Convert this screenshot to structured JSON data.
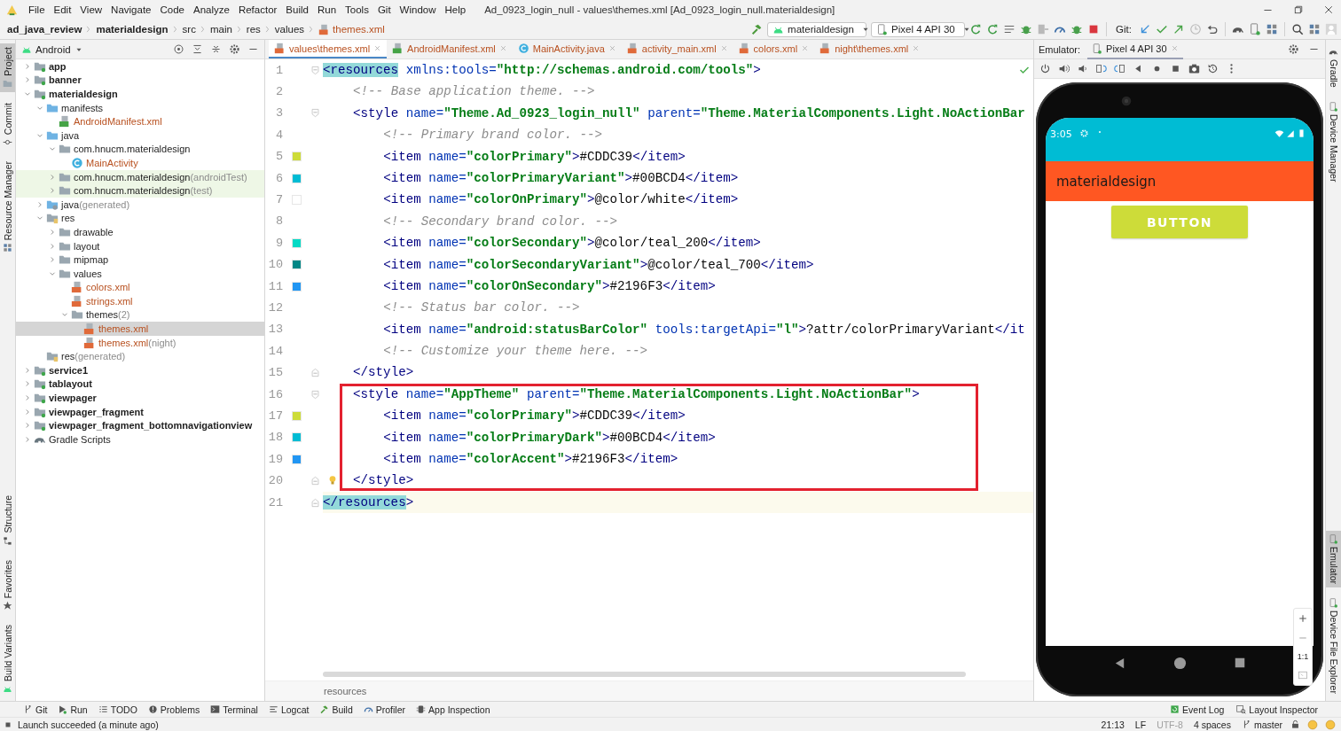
{
  "menu": [
    "File",
    "Edit",
    "View",
    "Navigate",
    "Code",
    "Analyze",
    "Refactor",
    "Build",
    "Run",
    "Tools",
    "Git",
    "Window",
    "Help"
  ],
  "window_title": "Ad_0923_login_null - values\\themes.xml [Ad_0923_login_null.materialdesign]",
  "breadcrumb": [
    {
      "label": "ad_java_review",
      "kind": "project"
    },
    {
      "label": "materialdesign",
      "kind": "module"
    },
    {
      "label": "src",
      "kind": "folder"
    },
    {
      "label": "main",
      "kind": "folder"
    },
    {
      "label": "res",
      "kind": "folder"
    },
    {
      "label": "values",
      "kind": "folder"
    },
    {
      "label": "themes.xml",
      "kind": "file"
    }
  ],
  "toolbar": {
    "run_config": "materialdesign",
    "device": "Pixel 4 API 30",
    "git_label": "Git:"
  },
  "left_tool_windows": {
    "top": [
      {
        "label": "Project",
        "selected": true
      },
      {
        "label": "Commit",
        "selected": false
      },
      {
        "label": "Resource Manager",
        "selected": false
      }
    ],
    "bottom": [
      {
        "label": "Structure",
        "selected": false
      },
      {
        "label": "Favorites",
        "selected": false
      },
      {
        "label": "Build Variants",
        "selected": false
      }
    ]
  },
  "project_panel": {
    "view": "Android",
    "tree": [
      {
        "label": "app",
        "kind": "module",
        "expanded": false,
        "selected": false,
        "highlighted": false
      },
      {
        "label": "banner",
        "kind": "module",
        "expanded": false,
        "selected": false,
        "highlighted": false
      },
      {
        "label": "materialdesign",
        "kind": "module",
        "expanded": true,
        "selected": false,
        "highlighted": false,
        "children": [
          {
            "label": "manifests",
            "kind": "source_folder",
            "expanded": true,
            "selected": false,
            "highlighted": false,
            "children": [
              {
                "label": "AndroidManifest.xml",
                "kind": "manifest",
                "selected": false,
                "highlighted": false
              }
            ]
          },
          {
            "label": "java",
            "kind": "source_folder",
            "expanded": true,
            "selected": false,
            "highlighted": false,
            "children": [
              {
                "label": "com.hnucm.materialdesign",
                "kind": "package",
                "expanded": true,
                "selected": false,
                "highlighted": false,
                "children": [
                  {
                    "label": "MainActivity",
                    "kind": "class",
                    "selected": false,
                    "highlighted": false
                  }
                ]
              },
              {
                "label": "com.hnucm.materialdesign",
                "suffix": "(androidTest)",
                "kind": "package",
                "expanded": false,
                "selected": false,
                "highlighted": true
              },
              {
                "label": "com.hnucm.materialdesign",
                "suffix": "(test)",
                "kind": "package",
                "expanded": false,
                "selected": false,
                "highlighted": true
              }
            ]
          },
          {
            "label": "java",
            "suffix": "(generated)",
            "kind": "generated_folder",
            "expanded": false,
            "selected": false,
            "highlighted": false
          },
          {
            "label": "res",
            "kind": "res_folder",
            "expanded": true,
            "selected": false,
            "highlighted": false,
            "children": [
              {
                "label": "drawable",
                "kind": "package",
                "expanded": false,
                "selected": false,
                "highlighted": false
              },
              {
                "label": "layout",
                "kind": "package",
                "expanded": false,
                "selected": false,
                "highlighted": false
              },
              {
                "label": "mipmap",
                "kind": "package",
                "expanded": false,
                "selected": false,
                "highlighted": false
              },
              {
                "label": "values",
                "kind": "package",
                "expanded": true,
                "selected": false,
                "highlighted": false,
                "children": [
                  {
                    "label": "colors.xml",
                    "kind": "xml",
                    "selected": false,
                    "highlighted": false
                  },
                  {
                    "label": "strings.xml",
                    "kind": "xml",
                    "selected": false,
                    "highlighted": false
                  },
                  {
                    "label": "themes",
                    "suffix": "(2)",
                    "kind": "package",
                    "expanded": true,
                    "selected": false,
                    "highlighted": false,
                    "children": [
                      {
                        "label": "themes.xml",
                        "kind": "xml",
                        "selected": true,
                        "highlighted": false
                      },
                      {
                        "label": "themes.xml",
                        "suffix": "(night)",
                        "kind": "xml",
                        "selected": false,
                        "highlighted": false
                      }
                    ]
                  }
                ]
              }
            ]
          },
          {
            "label": "res",
            "suffix": "(generated)",
            "kind": "res_folder",
            "selected": false,
            "highlighted": false
          }
        ]
      },
      {
        "label": "service1",
        "kind": "module",
        "expanded": false,
        "selected": false,
        "highlighted": false
      },
      {
        "label": "tablayout",
        "kind": "module",
        "expanded": false,
        "selected": false,
        "highlighted": false
      },
      {
        "label": "viewpager",
        "kind": "module",
        "expanded": false,
        "selected": false,
        "highlighted": false
      },
      {
        "label": "viewpager_fragment",
        "kind": "module",
        "expanded": false,
        "selected": false,
        "highlighted": false
      },
      {
        "label": "viewpager_fragment_bottomnavigationview",
        "kind": "module",
        "expanded": false,
        "selected": false,
        "highlighted": false
      },
      {
        "label": "Gradle Scripts",
        "kind": "gradle",
        "expanded": false,
        "selected": false,
        "highlighted": false
      }
    ]
  },
  "editor": {
    "tabs": [
      {
        "label": "values\\themes.xml",
        "kind": "xml",
        "selected": true
      },
      {
        "label": "AndroidManifest.xml",
        "kind": "manifest",
        "selected": false
      },
      {
        "label": "MainActivity.java",
        "kind": "class",
        "selected": false
      },
      {
        "label": "activity_main.xml",
        "kind": "xml",
        "selected": false
      },
      {
        "label": "colors.xml",
        "kind": "xml",
        "selected": false
      },
      {
        "label": "night\\themes.xml",
        "kind": "xml",
        "selected": false
      }
    ],
    "lines": [
      {
        "number": "1",
        "text": "<resources xmlns:tools=\"http://schemas.android.com/tools\">",
        "fold_open": true,
        "tag_highlight": true
      },
      {
        "number": "2",
        "text": "    <!-- Base application theme. -->"
      },
      {
        "number": "3",
        "text": "    <style name=\"Theme.Ad_0923_login_null\" parent=\"Theme.MaterialComponents.Light.NoActionBar",
        "fold_open": true
      },
      {
        "number": "4",
        "text": "        <!-- Primary brand color. -->"
      },
      {
        "number": "5",
        "text": "        <item name=\"colorPrimary\">#CDDC39</item>",
        "color": "#cddc39"
      },
      {
        "number": "6",
        "text": "        <item name=\"colorPrimaryVariant\">#00BCD4</item>",
        "color": "#00bcd4"
      },
      {
        "number": "7",
        "text": "        <item name=\"colorOnPrimary\">@color/white</item>",
        "color": "#ffffff"
      },
      {
        "number": "8",
        "text": "        <!-- Secondary brand color. -->"
      },
      {
        "number": "9",
        "text": "        <item name=\"colorSecondary\">@color/teal_200</item>",
        "color": "#03dac5"
      },
      {
        "number": "10",
        "text": "        <item name=\"colorSecondaryVariant\">@color/teal_700</item>",
        "color": "#018786"
      },
      {
        "number": "11",
        "text": "        <item name=\"colorOnSecondary\">#2196F3</item>",
        "color": "#2196f3"
      },
      {
        "number": "12",
        "text": "        <!-- Status bar color. -->"
      },
      {
        "number": "13",
        "text": "        <item name=\"android:statusBarColor\" tools:targetApi=\"l\">?attr/colorPrimaryVariant</it"
      },
      {
        "number": "14",
        "text": "        <!-- Customize your theme here. -->"
      },
      {
        "number": "15",
        "text": "    </style>",
        "fold_close": true
      },
      {
        "number": "16",
        "text": "    <style name=\"AppTheme\" parent=\"Theme.MaterialComponents.Light.NoActionBar\">",
        "fold_open": true,
        "boxed": true
      },
      {
        "number": "17",
        "text": "        <item name=\"colorPrimary\">#CDDC39</item>",
        "color": "#cddc39",
        "boxed": true
      },
      {
        "number": "18",
        "text": "        <item name=\"colorPrimaryDark\">#00BCD4</item>",
        "color": "#00bcd4",
        "boxed": true
      },
      {
        "number": "19",
        "text": "        <item name=\"colorAccent\">#2196F3</item>",
        "color": "#2196f3",
        "boxed": true
      },
      {
        "number": "20",
        "text": "    </style>",
        "fold_close": true,
        "bulb": true,
        "boxed": true
      },
      {
        "number": "21",
        "text": "</resources>",
        "fold_close": true,
        "tag_highlight": true,
        "current": true
      }
    ],
    "breadcrumb": "resources"
  },
  "emulator": {
    "label": "Emulator:",
    "tab": "Pixel 4 API 30",
    "device": {
      "time": "3:05",
      "app_title": "materialdesign",
      "button": "BUTTON"
    },
    "zoom_actual": "1:1"
  },
  "right_tool_windows": {
    "top": [
      {
        "label": "Gradle",
        "selected": false
      },
      {
        "label": "Device Manager",
        "selected": false
      }
    ],
    "bottom": [
      {
        "label": "Emulator",
        "selected": true
      },
      {
        "label": "Device File Explorer",
        "selected": false
      }
    ]
  },
  "bottom_tools": [
    "Git",
    "Run",
    "TODO",
    "Problems",
    "Terminal",
    "Logcat",
    "Build",
    "Profiler",
    "App Inspection"
  ],
  "bottom_tools_right": [
    "Event Log",
    "Layout Inspector"
  ],
  "status": {
    "message": "Launch succeeded (a minute ago)",
    "items": [
      {
        "label": "21:13",
        "disabled": false
      },
      {
        "label": "LF",
        "disabled": false
      },
      {
        "label": "UTF-8",
        "disabled": true
      },
      {
        "label": "4 spaces",
        "disabled": false
      },
      {
        "label": "master",
        "kind": "branch",
        "disabled": false
      }
    ]
  }
}
